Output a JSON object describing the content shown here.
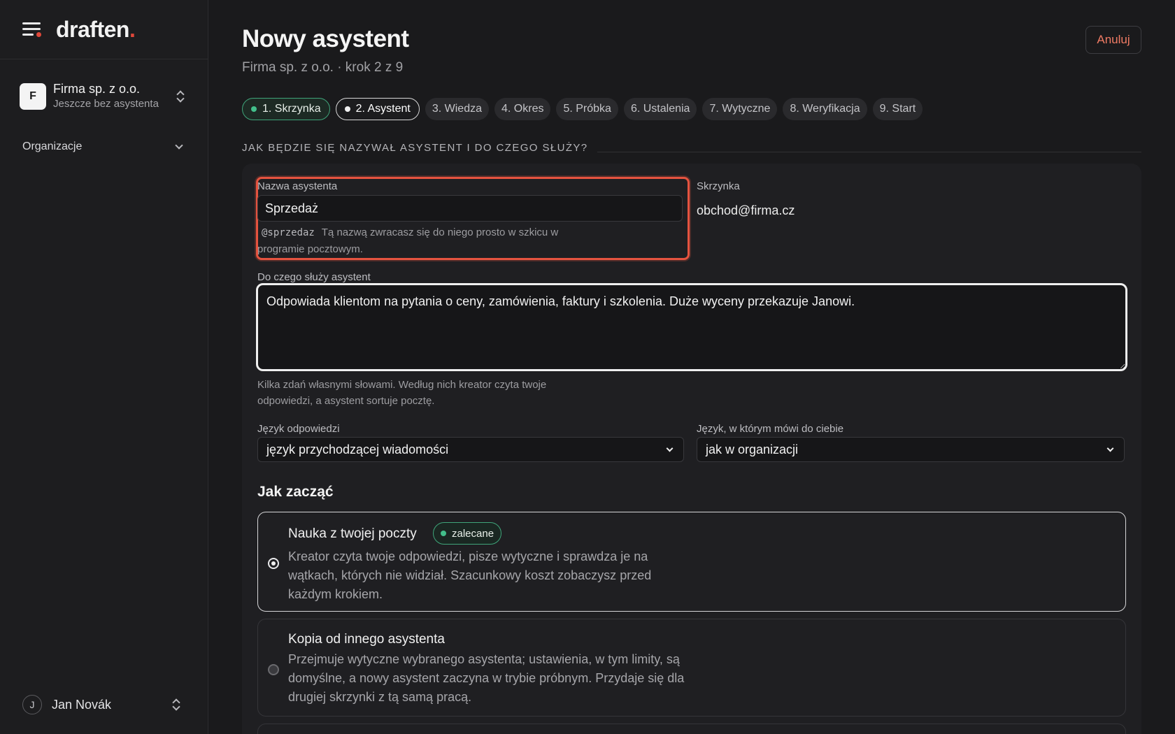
{
  "sidebar": {
    "logo_text": "draften",
    "logo_dot": ".",
    "org": {
      "initial": "F",
      "name": "Firma sp. z o.o.",
      "subtitle": "Jeszcze bez asystenta"
    },
    "nav_group": "Organizacje",
    "user": {
      "initial": "J",
      "name": "Jan Novák"
    }
  },
  "header": {
    "title": "Nowy asystent",
    "subtitle": "Firma sp. z o.o. · krok 2 z 9",
    "cancel_label": "Anuluj"
  },
  "steps": [
    {
      "label": "1. Skrzynka",
      "state": "done"
    },
    {
      "label": "2. Asystent",
      "state": "current"
    },
    {
      "label": "3. Wiedza",
      "state": "todo"
    },
    {
      "label": "4. Okres",
      "state": "todo"
    },
    {
      "label": "5. Próbka",
      "state": "todo"
    },
    {
      "label": "6. Ustalenia",
      "state": "todo"
    },
    {
      "label": "7. Wytyczne",
      "state": "todo"
    },
    {
      "label": "8. Weryfikacja",
      "state": "todo"
    },
    {
      "label": "9. Start",
      "state": "todo"
    }
  ],
  "form": {
    "section_title": "Jak będzie się nazywał asystent i do czego służy?",
    "name": {
      "label": "Nazwa asystenta",
      "value": "Sprzedaż",
      "handle": "@sprzedaz",
      "hint_line1": "Tą nazwą zwracasz się do niego prosto w szkicu w",
      "hint_line2": "programie pocztowym."
    },
    "mailbox": {
      "label": "Skrzynka",
      "value": "obchod@firma.cz"
    },
    "purpose": {
      "label": "Do czego służy asystent",
      "value": "Odpowiada klientom na pytania o ceny, zamówienia, faktury i szkolenia. Duże wyceny przekazuje Janowi.",
      "hint_line1": "Kilka zdań własnymi słowami. Według nich kreator czyta twoje",
      "hint_line2": "odpowiedzi, a asystent sortuje pocztę."
    },
    "reply_language": {
      "label": "Język odpowiedzi",
      "value": "język przychodzącej wiadomości"
    },
    "ui_language": {
      "label": "Język, w którym mówi do ciebie",
      "value": "jak w organizacji"
    }
  },
  "start": {
    "heading": "Jak zacząć",
    "options": [
      {
        "title": "Nauka z twojej poczty",
        "badge": "zalecane",
        "selected": true,
        "desc_lines": [
          "Kreator czyta twoje odpowiedzi, pisze wytyczne i sprawdza je na",
          "wątkach, których nie widział. Szacunkowy koszt zobaczysz przed",
          "każdym krokiem."
        ]
      },
      {
        "title": "Kopia od innego asystenta",
        "selected": false,
        "desc_lines": [
          "Przejmuje wytyczne wybranego asystenta; ustawienia, w tym limity, są",
          "domyślne, a nowy asystent zaczyna w trybie próbnym. Przydaje się dla",
          "drugiej skrzynki z tą samą pracą."
        ]
      }
    ]
  },
  "colors": {
    "background": "#1a1a1c",
    "accent_red": "#e5533f",
    "done_green": "#42c08b",
    "cancel_text": "#f07b64"
  }
}
